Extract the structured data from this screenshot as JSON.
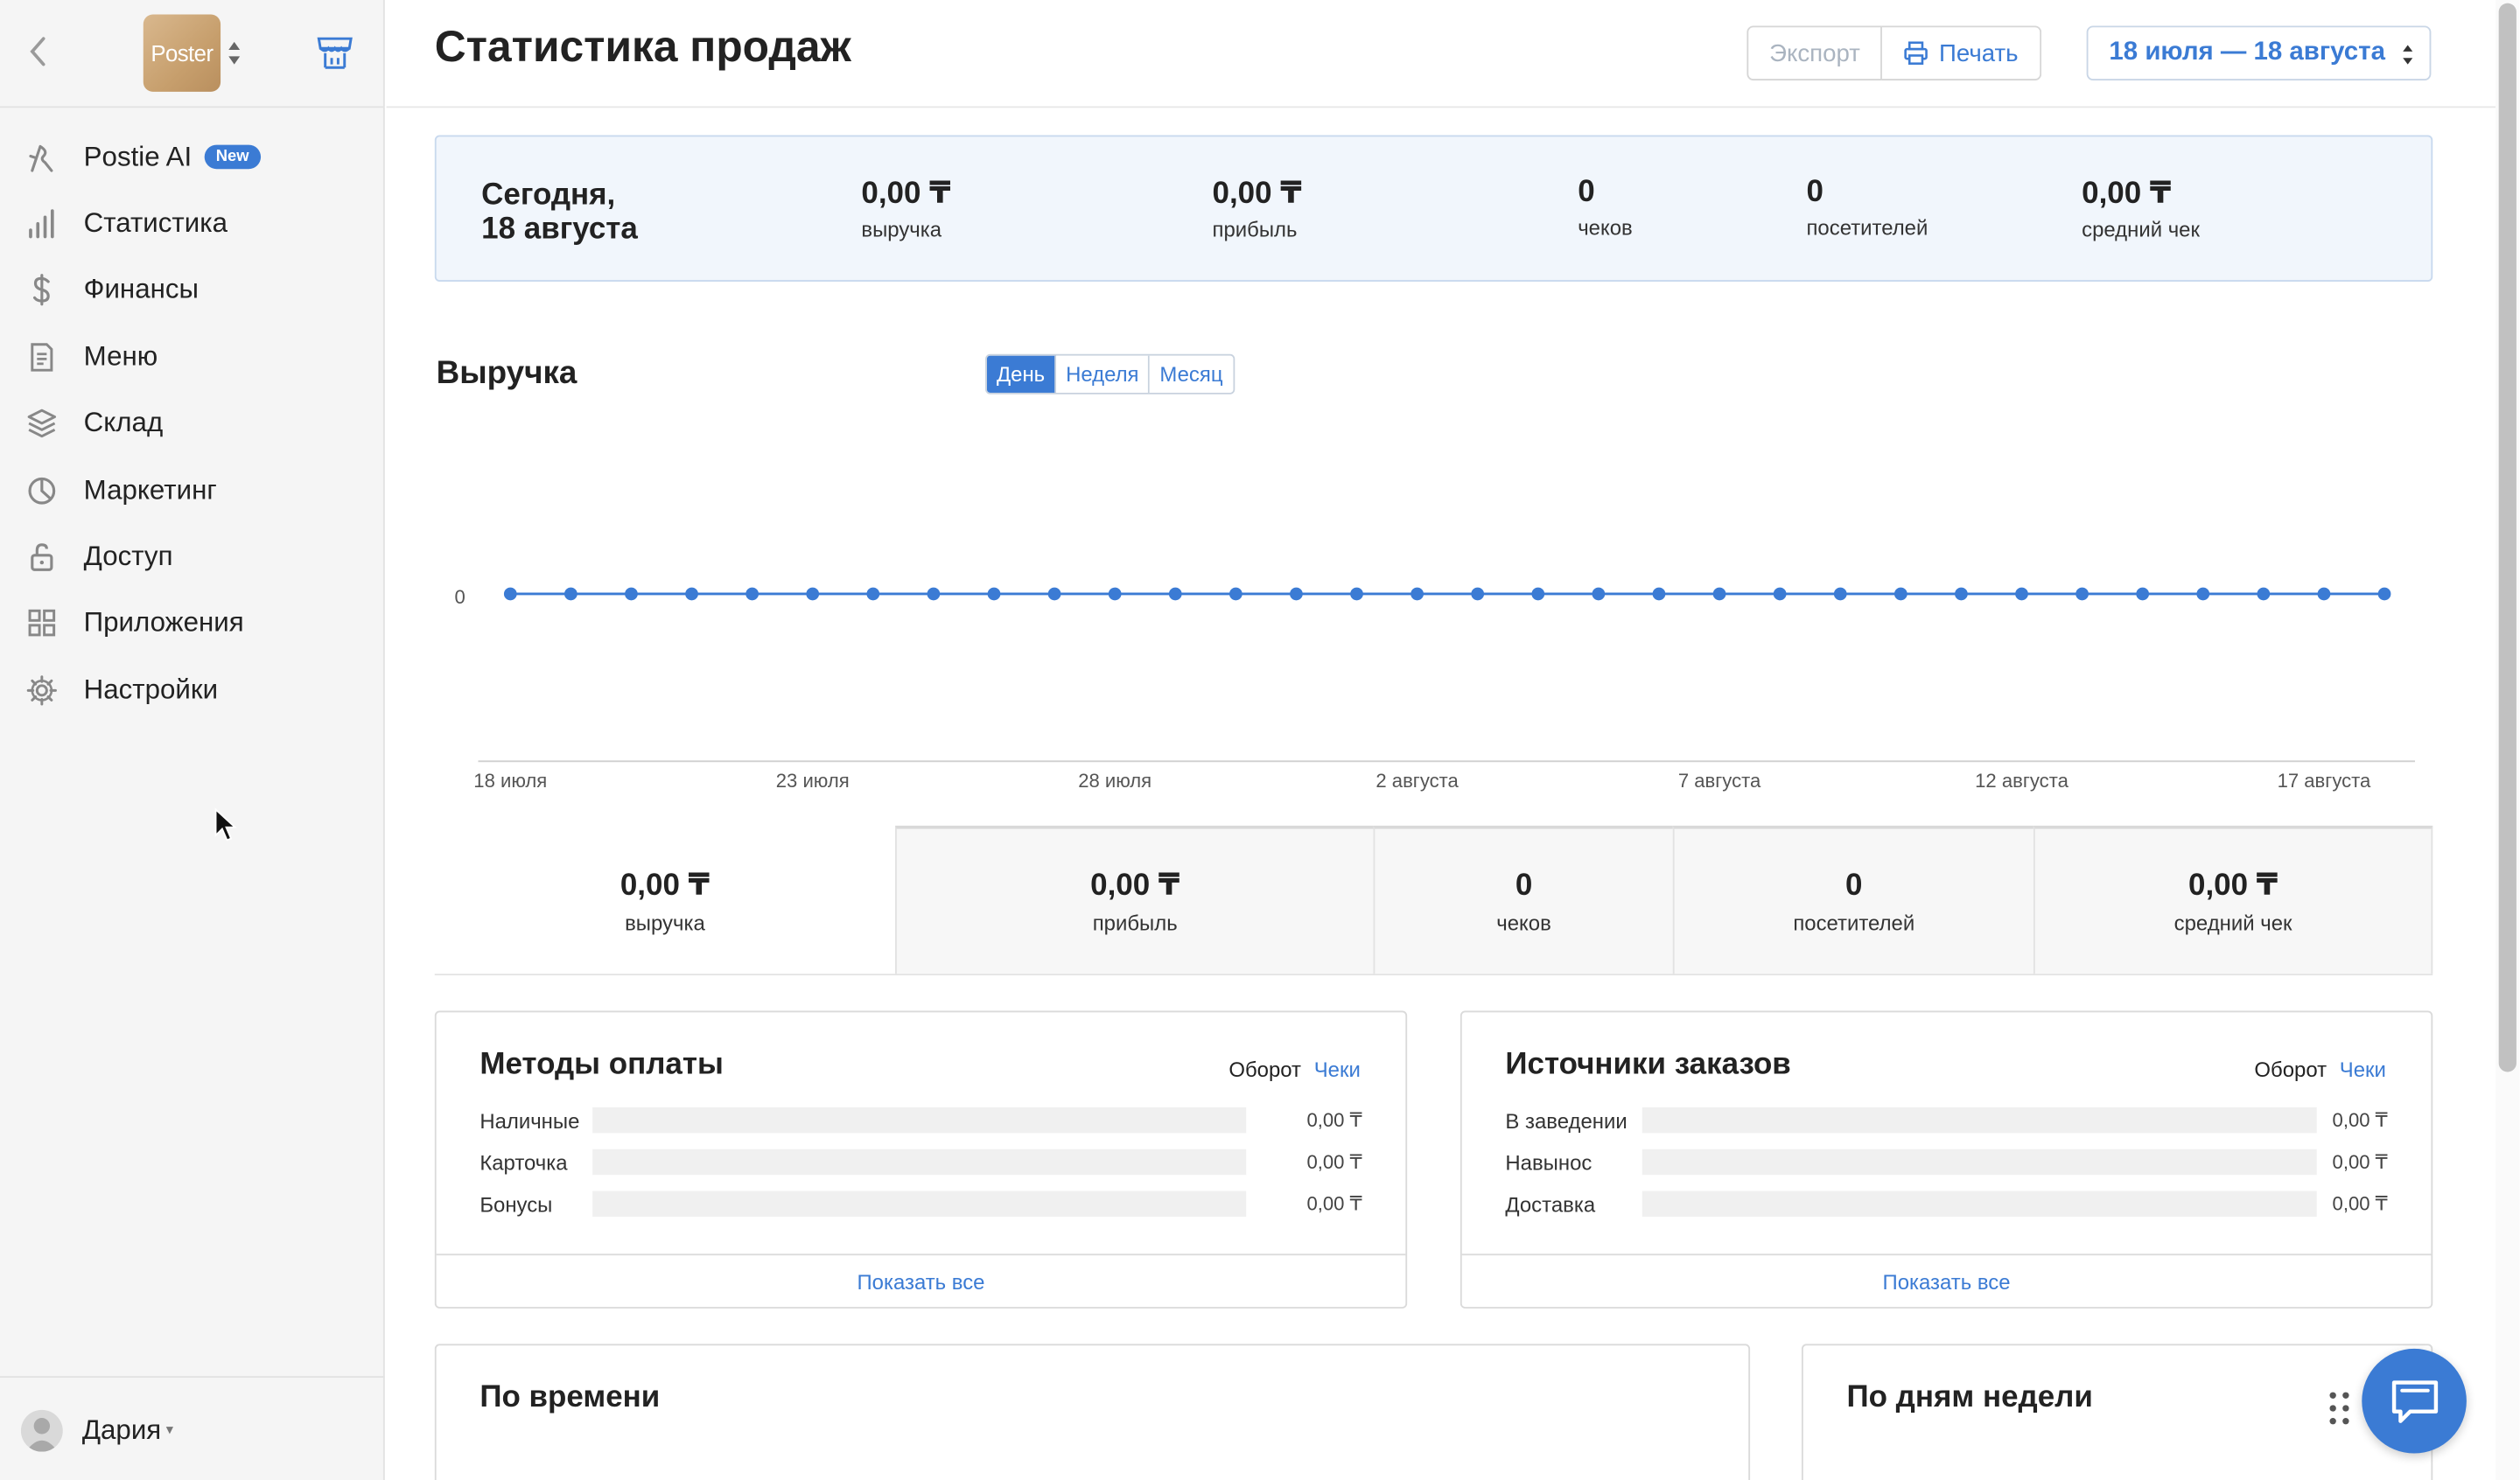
{
  "sidebar": {
    "logo_text": "Poster",
    "nav": [
      {
        "label": "Postie AI",
        "badge": "New"
      },
      {
        "label": "Статистика"
      },
      {
        "label": "Финансы"
      },
      {
        "label": "Меню"
      },
      {
        "label": "Склад"
      },
      {
        "label": "Маркетинг"
      },
      {
        "label": "Доступ"
      },
      {
        "label": "Приложения"
      },
      {
        "label": "Настройки"
      }
    ],
    "user": "Дария"
  },
  "header": {
    "title": "Статистика продаж",
    "export_label": "Экспорт",
    "print_label": "Печать",
    "date_range": "18 июля — 18 августа"
  },
  "today": {
    "title_line1": "Сегодня,",
    "title_line2": "18 августа",
    "stats": [
      {
        "value": "0,00 ₸",
        "label": "выручка"
      },
      {
        "value": "0,00 ₸",
        "label": "прибыль"
      },
      {
        "value": "0",
        "label": "чеков"
      },
      {
        "value": "0",
        "label": "посетителей"
      },
      {
        "value": "0,00 ₸",
        "label": "средний чек"
      }
    ]
  },
  "revenue": {
    "title": "Выручка",
    "periods": [
      "День",
      "Неделя",
      "Месяц"
    ],
    "active_period": "День"
  },
  "chart_data": {
    "type": "line",
    "x": [
      "18 июля",
      "19 июля",
      "20 июля",
      "21 июля",
      "22 июля",
      "23 июля",
      "24 июля",
      "25 июля",
      "26 июля",
      "27 июля",
      "28 июля",
      "29 июля",
      "30 июля",
      "31 июля",
      "1 августа",
      "2 августа",
      "3 августа",
      "4 августа",
      "5 августа",
      "6 августа",
      "7 августа",
      "8 августа",
      "9 августа",
      "10 августа",
      "11 августа",
      "12 августа",
      "13 августа",
      "14 августа",
      "15 августа",
      "16 августа",
      "17 августа",
      "18 августа"
    ],
    "series": [
      {
        "values": [
          0,
          0,
          0,
          0,
          0,
          0,
          0,
          0,
          0,
          0,
          0,
          0,
          0,
          0,
          0,
          0,
          0,
          0,
          0,
          0,
          0,
          0,
          0,
          0,
          0,
          0,
          0,
          0,
          0,
          0,
          0,
          0
        ]
      }
    ],
    "x_tick_labels": [
      "18 июля",
      "23 июля",
      "28 июля",
      "2 августа",
      "7 августа",
      "12 августа",
      "17 августа"
    ],
    "y_tick_labels": [
      "0"
    ],
    "color": "#3b7bd4",
    "grid": false
  },
  "metric_tabs": [
    {
      "value": "0,00 ₸",
      "label": "выручка"
    },
    {
      "value": "0,00 ₸",
      "label": "прибыль"
    },
    {
      "value": "0",
      "label": "чеков"
    },
    {
      "value": "0",
      "label": "посетителей"
    },
    {
      "value": "0,00 ₸",
      "label": "средний чек"
    }
  ],
  "payment_methods": {
    "title": "Методы оплаты",
    "toggle_a": "Оборот",
    "toggle_b": "Чеки",
    "rows": [
      {
        "name": "Наличные",
        "value": "0,00 ₸"
      },
      {
        "name": "Карточка",
        "value": "0,00 ₸"
      },
      {
        "name": "Бонусы",
        "value": "0,00 ₸"
      }
    ],
    "show_all": "Показать все"
  },
  "order_sources": {
    "title": "Источники заказов",
    "toggle_a": "Оборот",
    "toggle_b": "Чеки",
    "rows": [
      {
        "name": "В заведении",
        "value": "0,00 ₸"
      },
      {
        "name": "Навынос",
        "value": "0,00 ₸"
      },
      {
        "name": "Доставка",
        "value": "0,00 ₸"
      }
    ],
    "show_all": "Показать все"
  },
  "by_time": {
    "title": "По времени"
  },
  "by_weekday": {
    "title": "По дням недели"
  },
  "colors": {
    "accent": "#3b7bd4",
    "sidebar_bg": "#f5f5f5",
    "today_bg": "#f1f6fc"
  }
}
